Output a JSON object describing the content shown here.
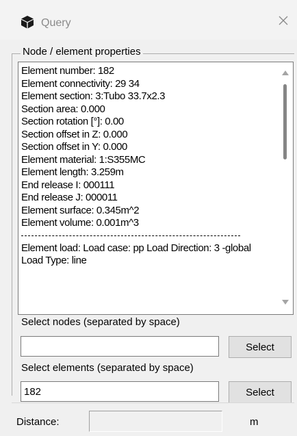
{
  "window": {
    "title": "Query",
    "icon": "cube-icon",
    "close_icon": "close-icon"
  },
  "group": {
    "legend": "Node / element properties"
  },
  "properties": {
    "lines": [
      "Element number: 182",
      "Element connectivity:  29 34",
      "Element section: 3:Tubo 33.7x2.3",
      "Section area: 0.000",
      "Section rotation [°]: 0.00",
      "Section offset in Z: 0.000",
      "Section offset in Y: 0.000",
      "Element material: 1:S355MC",
      "Element length: 3.259m",
      "End release I: 000111",
      "End release J: 000011",
      "Element surface: 0.345m^2",
      "Element volume: 0.001m^3"
    ],
    "load_text": "Element load: Load case: pp Load Direction: 3 -global Load Type: line"
  },
  "select_nodes": {
    "label": "Select nodes (separated by space)",
    "value": "",
    "button_label": "Select"
  },
  "select_elements": {
    "label": "Select elements (separated by space)",
    "value": "182",
    "button_label": "Select"
  },
  "distance": {
    "label": "Distance:",
    "value": "",
    "unit": "m"
  }
}
